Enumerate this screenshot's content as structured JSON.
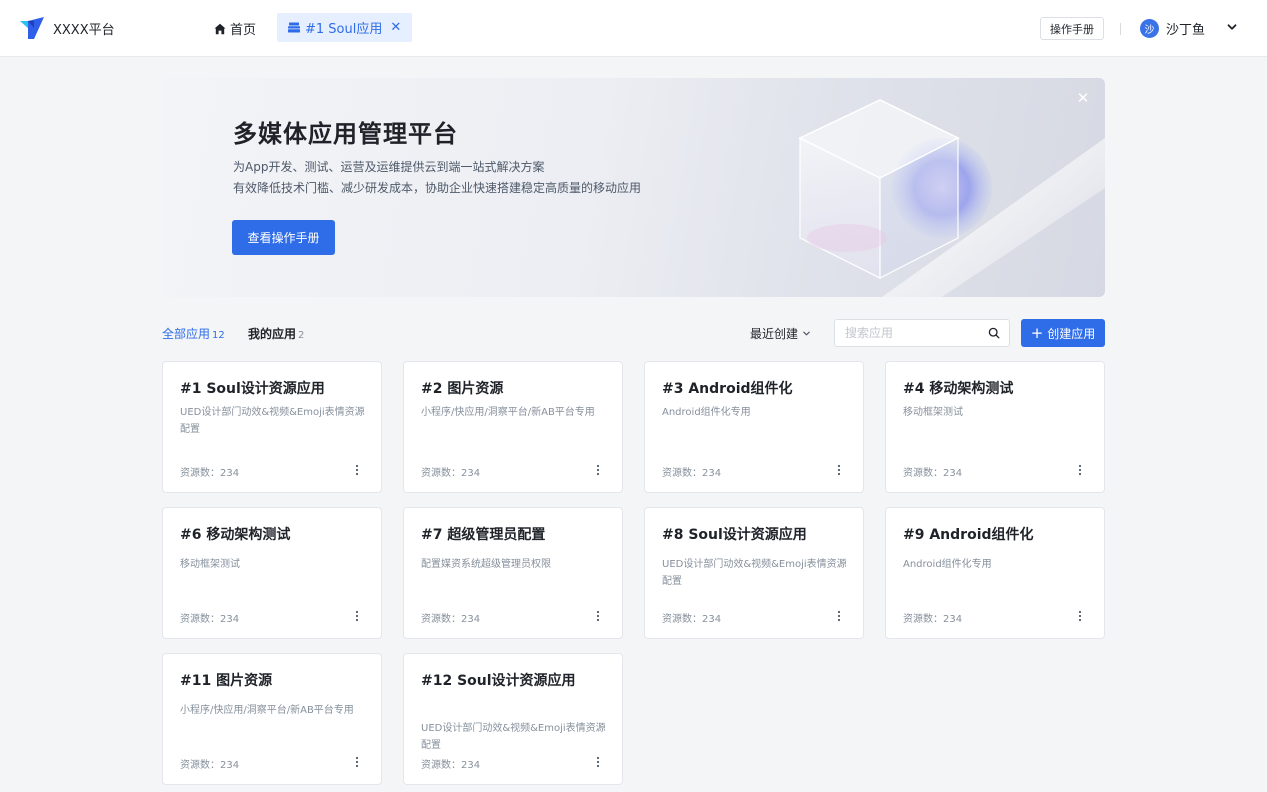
{
  "header": {
    "brand": "XXXX平台",
    "home_label": "首页",
    "active_tab_label": "#1 Soul应用",
    "manual_label": "操作手册",
    "avatar_text": "沙",
    "username": "沙丁鱼"
  },
  "banner": {
    "title": "多媒体应用管理平台",
    "line1": "为App开发、测试、运营及运维提供云到端一站式解决方案",
    "line2": "有效降低技术门槛、减少研发成本，协助企业快速搭建稳定高质量的移动应用",
    "button_label": "查看操作手册"
  },
  "filters": {
    "all_label": "全部应用",
    "all_count": "12",
    "mine_label": "我的应用",
    "mine_count": "2",
    "sort_label": "最近创建",
    "search_placeholder": "搜索应用",
    "create_label": "创建应用"
  },
  "apps": [
    {
      "title": "#1 Soul设计资源应用",
      "desc": "UED设计部门动效&视频&Emoji表情资源配置",
      "count": "资源数：234"
    },
    {
      "title": "#2 图片资源",
      "desc": "小程序/快应用/洞察平台/新AB平台专用",
      "count": "资源数：234"
    },
    {
      "title": "#3 Android组件化",
      "desc": "Android组件化专用",
      "count": "资源数：234"
    },
    {
      "title": "#4 移动架构测试",
      "desc": "移动框架测试",
      "count": "资源数：234"
    },
    {
      "title": "#6 移动架构测试",
      "desc": "移动框架测试",
      "count": "资源数：234"
    },
    {
      "title": "#7 超级管理员配置",
      "desc": "配置媒资系统超级管理员权限",
      "count": "资源数：234"
    },
    {
      "title": "#8 Soul设计资源应用",
      "desc": "UED设计部门动效&视频&Emoji表情资源配置",
      "count": "资源数：234"
    },
    {
      "title": "#9 Android组件化",
      "desc": "Android组件化专用",
      "count": "资源数：234"
    },
    {
      "title": "#11 图片资源",
      "desc": "小程序/快应用/洞察平台/新AB平台专用",
      "count": "资源数：234"
    },
    {
      "title": "#12 Soul设计资源应用",
      "desc": "UED设计部门动效&视频&Emoji表情资源配置",
      "count": "资源数：234"
    }
  ],
  "colors": {
    "accent": "#2f6ce8",
    "tab_bg": "#e6efff",
    "page_bg": "#f4f5f7"
  },
  "icons": {
    "logo": "brand-logo-icon",
    "home": "home-icon",
    "tab": "app-stack-icon",
    "tab_close": "close-icon",
    "user_menu": "chevron-down-icon",
    "banner_close": "close-icon",
    "sort": "chevron-down-icon",
    "search": "search-icon",
    "create": "plus-icon",
    "card_more": "more-vertical-icon"
  }
}
